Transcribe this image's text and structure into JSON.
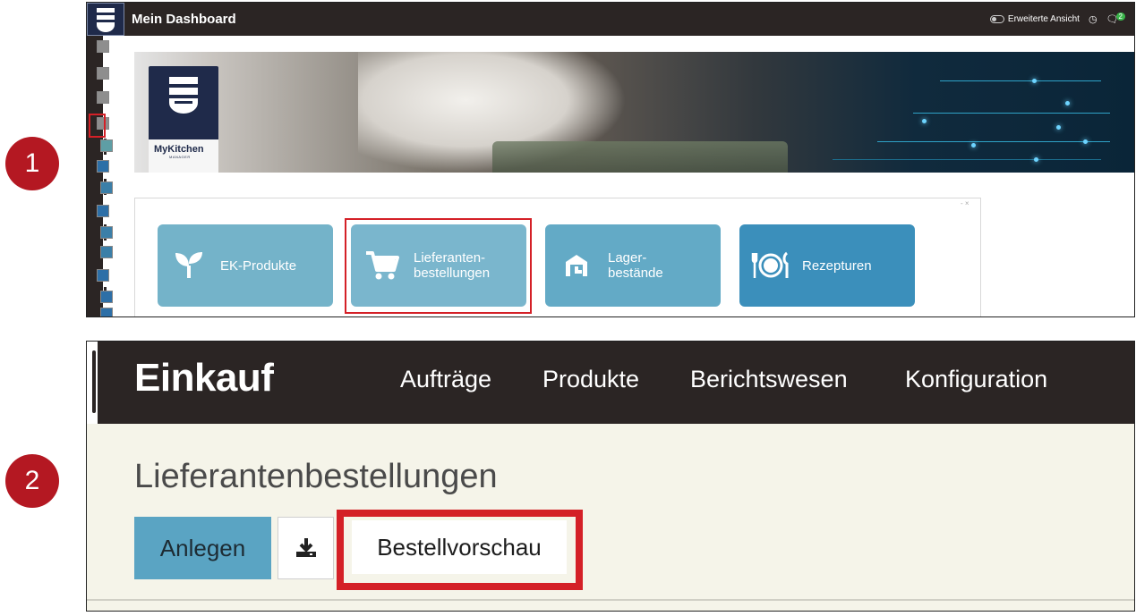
{
  "steps": [
    "1",
    "2"
  ],
  "dashboard": {
    "title": "Mein Dashboard",
    "extended_view_label": "Erweiterte Ansicht",
    "notification_count": "2",
    "brand_name": "MyKitchen",
    "brand_sub": "MANAGER",
    "tiles_close": "- ×",
    "tiles": [
      {
        "label": "EK-Produkte",
        "icon": "sprout-icon",
        "color": "#74b3c9"
      },
      {
        "label": "Lieferanten-\nbestellungen",
        "icon": "cart-icon",
        "color": "#7ab6cd"
      },
      {
        "label": "Lager-\nbestände",
        "icon": "warehouse-icon",
        "color": "#63aac6"
      },
      {
        "label": "Rezepturen",
        "icon": "plate-cutlery-icon",
        "color": "#3b8fbb"
      }
    ]
  },
  "purchase": {
    "brand": "Einkauf",
    "nav": [
      "Aufträge",
      "Produkte",
      "Berichtswesen",
      "Konfiguration"
    ],
    "page_title": "Lieferantenbestellungen",
    "create_label": "Anlegen",
    "download_icon": "download-icon",
    "preview_label": "Bestellvorschau"
  },
  "colors": {
    "highlight": "#d42027",
    "badge": "#b41822",
    "header": "#2b2524",
    "primary_button": "#5aa4c3"
  }
}
